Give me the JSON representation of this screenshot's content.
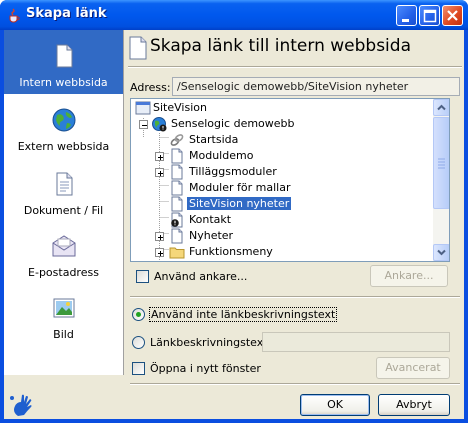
{
  "window": {
    "title": "Skapa länk"
  },
  "sidebar": {
    "items": [
      {
        "label": "Intern webbsida",
        "icon": "page-icon",
        "selected": true
      },
      {
        "label": "Extern webbsida",
        "icon": "globe-icon",
        "selected": false
      },
      {
        "label": "Dokument / Fil",
        "icon": "document-icon",
        "selected": false
      },
      {
        "label": "E-postadress",
        "icon": "envelope-icon",
        "selected": false
      },
      {
        "label": "Bild",
        "icon": "image-icon",
        "selected": false
      }
    ]
  },
  "main": {
    "title": "Skapa länk till intern webbsida",
    "address_label": "Adress:",
    "address_value": "/Senselogic demowebb/SiteVision nyheter"
  },
  "tree": {
    "nodes": [
      {
        "label": "SiteVision",
        "icon": "sitevision-icon",
        "expander": "none"
      },
      {
        "label": "Senselogic demowebb",
        "icon": "globe-icon",
        "expander": "minus"
      },
      {
        "label": "Startsida",
        "icon": "link-icon",
        "expander": "none"
      },
      {
        "label": "Moduldemo",
        "icon": "page-icon",
        "expander": "plus"
      },
      {
        "label": "Tilläggsmoduler",
        "icon": "page-icon",
        "expander": "plus"
      },
      {
        "label": "Moduler för mallar",
        "icon": "page-icon",
        "expander": "none"
      },
      {
        "label": "SiteVision nyheter",
        "icon": "page-icon",
        "expander": "none",
        "selected": true
      },
      {
        "label": "Kontakt",
        "icon": "page-info-icon",
        "expander": "none"
      },
      {
        "label": "Nyheter",
        "icon": "page-icon",
        "expander": "plus"
      },
      {
        "label": "Funktionsmeny",
        "icon": "folder-icon",
        "expander": "plus"
      }
    ]
  },
  "options": {
    "use_anchor_label": "Använd ankare...",
    "anchor_button": "Ankare...",
    "no_description_label": "Använd inte länkbeskrivningstext",
    "description_label": "Länkbeskrivningstext:",
    "description_value": "",
    "new_window_label": "Öppna i nytt fönster",
    "advanced_button": "Avancerat",
    "selected_radio": "no_description"
  },
  "buttons": {
    "ok": "OK",
    "cancel": "Avbryt"
  },
  "colors": {
    "titlebar": "#0058ee",
    "selection": "#316ac5",
    "dialog_bg": "#ece9d8"
  }
}
